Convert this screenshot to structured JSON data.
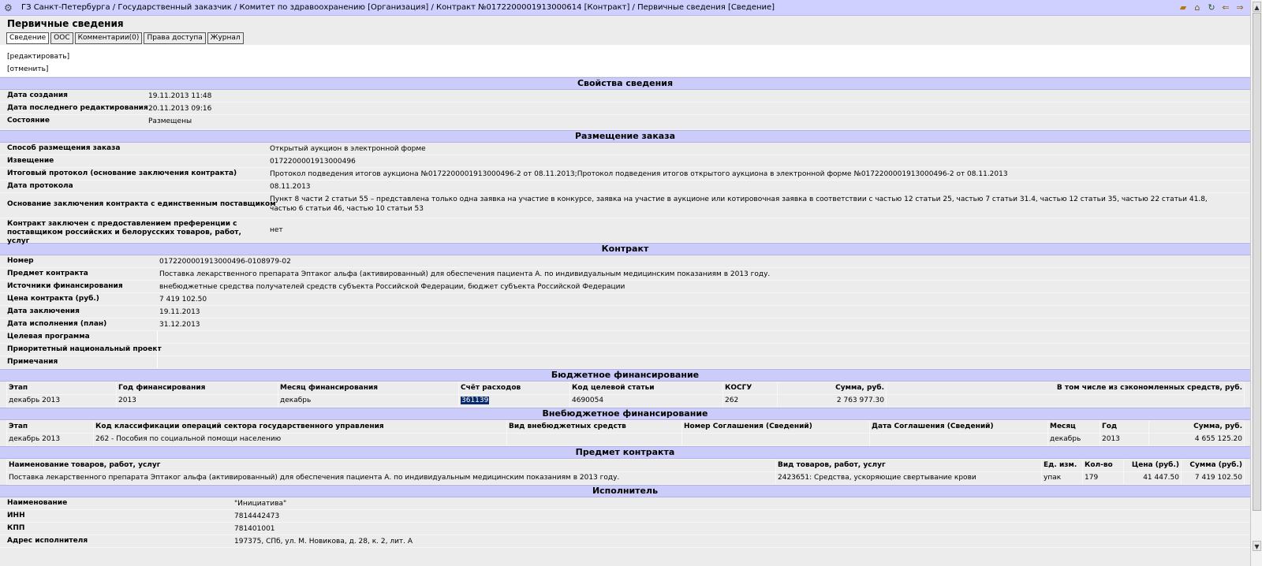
{
  "breadcrumb": "ГЗ Санкт-Петербурга / Государственный заказчик / Комитет по здравоохранению [Организация] / Контракт №0172200001913000614 [Контракт] / Первичные сведения [Сведение]",
  "page_title": "Первичные сведения",
  "tabs": [
    "Сведение",
    "ООС",
    "Комментарии(0)",
    "Права доступа",
    "Журнал"
  ],
  "actions": {
    "edit": "[редактировать]",
    "cancel": "[отменить]"
  },
  "props": {
    "title": "Свойства сведения",
    "rows": [
      {
        "k": "Дата создания",
        "v": "19.11.2013 11:48"
      },
      {
        "k": "Дата последнего редактирования",
        "v": "20.11.2013 09:16"
      },
      {
        "k": "Состояние",
        "v": "Размещены"
      }
    ]
  },
  "placement": {
    "title": "Размещение заказа",
    "rows": [
      {
        "k": "Способ размещения заказа",
        "v": "Открытый аукцион в электронной форме"
      },
      {
        "k": "Извещение",
        "v": "0172200001913000496"
      },
      {
        "k": "Итоговый протокол (основание заключения контракта)",
        "v": "Протокол подведения итогов аукциона №0172200001913000496-2 от 08.11.2013;Протокол подведения итогов открытого аукциона в электронной форме №0172200001913000496-2 от 08.11.2013"
      },
      {
        "k": "Дата протокола",
        "v": "08.11.2013"
      },
      {
        "k": "Основание заключения контракта с единственным поставщиком",
        "v": "Пункт 8 части 2 статьи 55 – представлена только одна заявка на участие в конкурсе, заявка на участие в аукционе или котировочная заявка в соответствии с частью 12 статьи 25, частью 7 статьи 31.4, частью 12 статьи 35, частью 22 статьи 41.8, частью 6 статьи 46, частью 10 статьи 53"
      },
      {
        "k": "Контракт заключен с предоставлением преференции с поставщиком российских и белорусских товаров, работ, услуг",
        "v": "нет"
      }
    ]
  },
  "contract": {
    "title": "Контракт",
    "rows": [
      {
        "k": "Номер",
        "v": "0172200001913000496-0108979-02"
      },
      {
        "k": "Предмет контракта",
        "v": "Поставка лекарственного препарата Эптаког альфа (активированный) для обеспечения пациента А. по индивидуальным медицинским показаниям в 2013 году."
      },
      {
        "k": "Источники финансирования",
        "v": "внебюджетные средства получателей средств субъекта Российской Федерации, бюджет субъекта Российской Федерации"
      },
      {
        "k": "Цена контракта (руб.)",
        "v": "7 419 102.50"
      },
      {
        "k": "Дата заключения",
        "v": "19.11.2013"
      },
      {
        "k": "Дата исполнения (план)",
        "v": "31.12.2013"
      },
      {
        "k": "Целевая программа",
        "v": ""
      },
      {
        "k": "Приоритетный национальный проект",
        "v": ""
      },
      {
        "k": "Примечания",
        "v": ""
      }
    ]
  },
  "budget": {
    "title": "Бюджетное финансирование",
    "headers": [
      "Этап",
      "Год финансирования",
      "Месяц финансирования",
      "Счёт расходов",
      "Код целевой статьи",
      "КОСГУ",
      "Сумма, руб.",
      "В том числе из сэкономленных средств, руб."
    ],
    "row": [
      "декабрь 2013",
      "2013",
      "декабрь",
      "361139",
      "4690054",
      "262",
      "2 763 977.30",
      ""
    ]
  },
  "offbudget": {
    "title": "Внебюджетное финансирование",
    "headers": [
      "Этап",
      "Код классификации операций сектора государственного управления",
      "Вид внебюджетных средств",
      "Номер Соглашения (Сведений)",
      "Дата Соглашения (Сведений)",
      "Месяц",
      "Год",
      "Сумма, руб."
    ],
    "row": [
      "декабрь 2013",
      "262 - Пособия по социальной помощи населению",
      "",
      "",
      "",
      "декабрь",
      "2013",
      "4 655 125.20"
    ]
  },
  "subject": {
    "title": "Предмет контракта",
    "headers": [
      "Наименование товаров, работ, услуг",
      "Вид товаров, работ, услуг",
      "Ед. изм.",
      "Кол-во",
      "Цена (руб.)",
      "Сумма (руб.)"
    ],
    "row": [
      "Поставка лекарственного препарата Эптаког альфа (активированный) для обеспечения пациента А. по индивидуальным медицинским показаниям в 2013 году.",
      "2423651: Средства, ускоряющие свертывание крови",
      "упак",
      "179",
      "41 447.50",
      "7 419 102.50"
    ]
  },
  "executor": {
    "title": "Исполнитель",
    "rows": [
      {
        "k": "Наименование",
        "v": "\"Инициатива\""
      },
      {
        "k": "ИНН",
        "v": "7814442473"
      },
      {
        "k": "КПП",
        "v": "781401001"
      },
      {
        "k": "Адрес исполнителя",
        "v": "197375, СПб, ул. М. Новикова, д. 28, к. 2, лит. А"
      }
    ]
  },
  "icons": [
    "settings-icon",
    "folder-icon",
    "home-icon",
    "refresh-icon",
    "back-arrow-icon",
    "forward-arrow-icon"
  ]
}
